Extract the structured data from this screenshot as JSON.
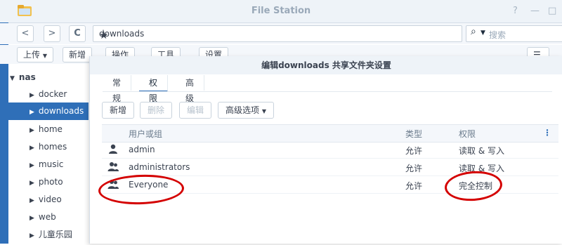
{
  "window": {
    "title": "File Station",
    "help": "?",
    "minimize": "—",
    "maximize": "□"
  },
  "addressbar": {
    "back": "<",
    "forward": ">",
    "refresh": "C",
    "path": "downloads",
    "search_placeholder": "搜索"
  },
  "toolbar": {
    "upload": "上传",
    "new": "新增",
    "action": "操作",
    "tools": "工具",
    "settings": "设置"
  },
  "sidebar": {
    "root": "nas",
    "items": [
      {
        "label": "docker"
      },
      {
        "label": "downloads"
      },
      {
        "label": "home"
      },
      {
        "label": "homes"
      },
      {
        "label": "music"
      },
      {
        "label": "photo"
      },
      {
        "label": "video"
      },
      {
        "label": "web"
      },
      {
        "label": "儿童乐园"
      }
    ]
  },
  "dialog": {
    "title": "编辑downloads 共享文件夹设置",
    "tabs": [
      {
        "label": "常规"
      },
      {
        "label": "权限"
      },
      {
        "label": "高级权限"
      }
    ],
    "actions": {
      "new": "新增",
      "delete": "删除",
      "edit": "编辑",
      "advanced": "高级选项"
    },
    "table": {
      "headers": {
        "user": "用户或组",
        "type": "类型",
        "permission": "权限"
      },
      "rows": [
        {
          "name": "admin",
          "type": "允许",
          "permission": "读取 & 写入"
        },
        {
          "name": "administrators",
          "type": "允许",
          "permission": "读取 & 写入"
        },
        {
          "name": "Everyone",
          "type": "允许",
          "permission": "完全控制"
        }
      ]
    }
  },
  "colors": {
    "accent": "#2f6fb8",
    "annotation": "#d40000"
  }
}
